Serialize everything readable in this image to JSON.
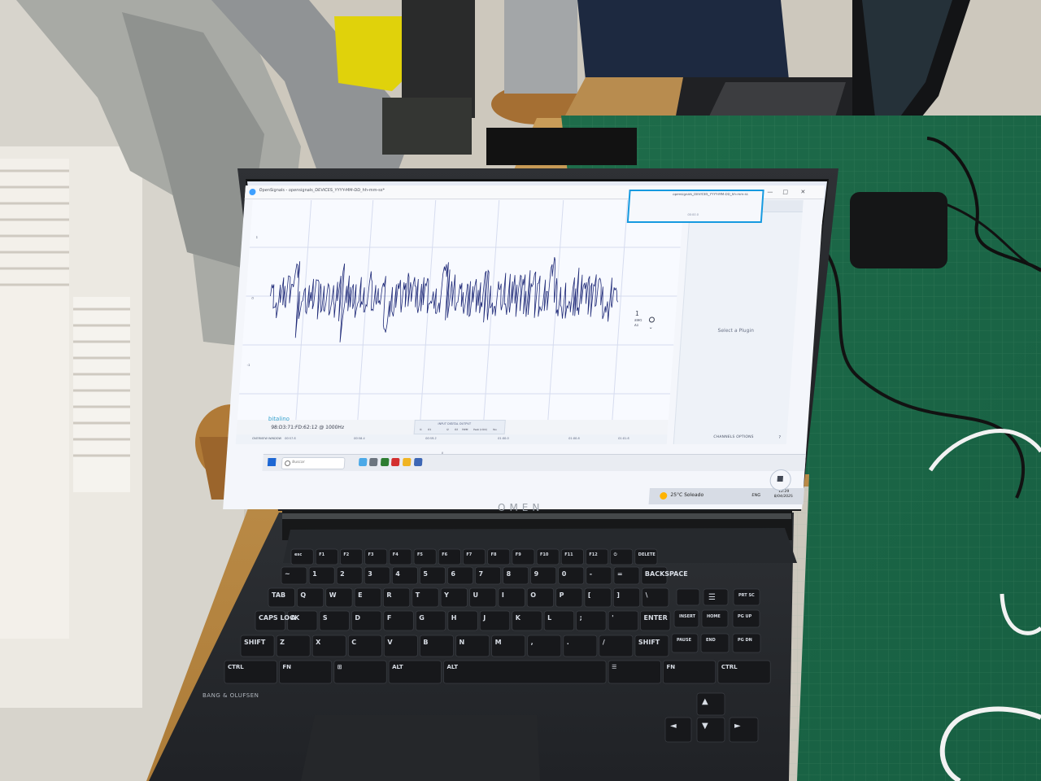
{
  "window": {
    "title": "OpenSignals - opensignals_DEVICES_YYYY-MM-DD_hh-mm-ss*",
    "minimize_icon": "minimize-icon",
    "maximize_icon": "maximize-icon",
    "close_icon": "close-icon"
  },
  "plot": {
    "device_label": "98:D3:71:FD:62:12 @ 1000Hz",
    "brand": "bitalino",
    "ticks_x": [
      "00:57.6",
      "00:58.4",
      "00:59.2",
      "01:00.0",
      "01:00.8",
      "01:01.6",
      "01:02.4"
    ],
    "channel_label": "1",
    "channel_type": "EMG",
    "channel_unit": "A1",
    "toolbar_label": "OVERVIEW WINDOW",
    "input_panel": {
      "label": "INPUT DIGITAL OUTPUT",
      "controls": [
        "I1",
        "O1",
        "I2",
        "O2"
      ],
      "pwm": "PWM",
      "mode": "Peak (click)",
      "yes": "Yes"
    }
  },
  "side_panel": {
    "message": "Select a Plugin",
    "footer": "CHANNELS OPTIONS",
    "help": "?"
  },
  "taskbar": {
    "search_placeholder": "Buscar",
    "mini_window_title": "opensignals_DEVICES_YYYY-MM-DD_hh-mm-ss",
    "mini_window_time": "00:00.0",
    "weather": "25°C Soleado",
    "language": "ENG",
    "time": "12:29",
    "date": "8/04/2025"
  },
  "device": {
    "model": "OMEN",
    "brand": "BANG & OLUFSEN"
  },
  "keyboard": {
    "keys_row1": [
      "esc",
      "F1",
      "F2",
      "F3",
      "F4",
      "F5",
      "F6",
      "F7",
      "F8",
      "F9",
      "F10",
      "F11",
      "F12",
      "⏻",
      "DELETE"
    ],
    "keys_row2": [
      "~",
      "1",
      "2",
      "3",
      "4",
      "5",
      "6",
      "7",
      "8",
      "9",
      "0",
      "-",
      "=",
      "BACKSPACE",
      "HOME",
      "PGUP"
    ],
    "keys_row3": [
      "TAB",
      "Q",
      "W",
      "E",
      "R",
      "T",
      "Y",
      "U",
      "I",
      "O",
      "P",
      "[",
      "]",
      "\\",
      "INSERT",
      "HOME",
      "PG UP"
    ],
    "keys_row4": [
      "CAPS LOCK",
      "A",
      "S",
      "D",
      "F",
      "G",
      "H",
      "J",
      "K",
      "L",
      ";",
      "'",
      "ENTER",
      "PAUSE",
      "END",
      "PG DN"
    ],
    "keys_row5": [
      "SHIFT",
      "Z",
      "X",
      "C",
      "V",
      "B",
      "N",
      "M",
      ",",
      ".",
      "/",
      "SHIFT",
      "▲"
    ],
    "keys_row6": [
      "CTRL",
      "FN",
      "⊞",
      "ALT",
      "ALT",
      "☰",
      "FN",
      "CTRL",
      "◄",
      "▼",
      "►"
    ]
  },
  "colors": {
    "signal": "#1f2a78",
    "taskbar_accent": "#169ae0",
    "screen_bg": "#f4f6fb",
    "weather": "#ffb300"
  }
}
